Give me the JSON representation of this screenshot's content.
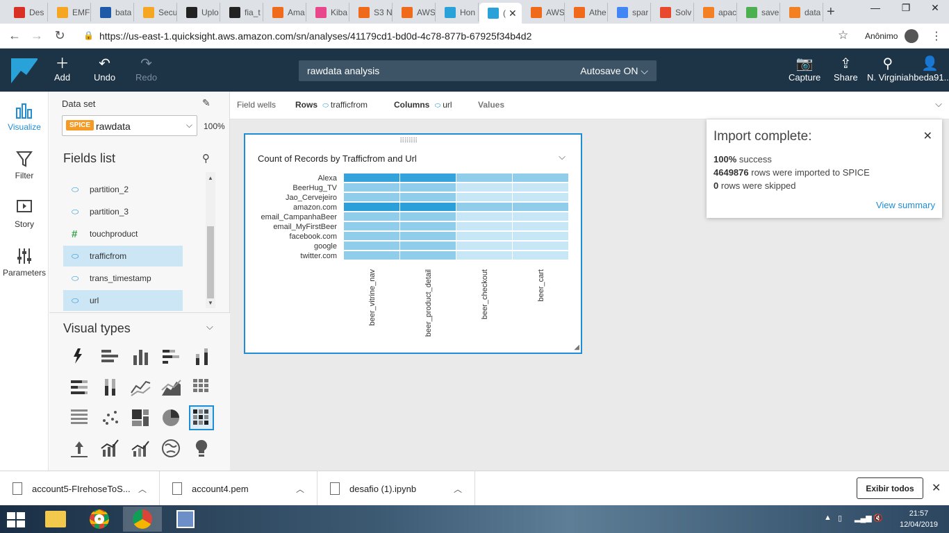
{
  "browser": {
    "tabs": [
      {
        "label": "Des",
        "favicon": "gmail-icon",
        "color": "#d93025"
      },
      {
        "label": "EMF",
        "favicon": "aws-icon",
        "color": "#f5a623"
      },
      {
        "label": "bata",
        "favicon": "feather-icon",
        "color": "#1e5aa8"
      },
      {
        "label": "Secu",
        "favicon": "aws-icon",
        "color": "#f5a623"
      },
      {
        "label": "Uplo",
        "favicon": "github-icon",
        "color": "#222222"
      },
      {
        "label": "fia_t",
        "favicon": "github-icon",
        "color": "#222222"
      },
      {
        "label": "Ama",
        "favicon": "aws-service-icon",
        "color": "#f06a1c"
      },
      {
        "label": "Kiba",
        "favicon": "kibana-icon",
        "color": "#e8478b"
      },
      {
        "label": "S3 N",
        "favicon": "aws-service-icon",
        "color": "#f06a1c"
      },
      {
        "label": "AWS",
        "favicon": "aws-service-icon",
        "color": "#f06a1c"
      },
      {
        "label": "Hon",
        "favicon": "quicksight-icon",
        "color": "#29a1d9"
      },
      {
        "label": "(",
        "favicon": "quicksight-icon",
        "color": "#29a1d9"
      },
      {
        "label": "AWS",
        "favicon": "aws-service-icon",
        "color": "#f06a1c"
      },
      {
        "label": "Athe",
        "favicon": "aws-service-icon",
        "color": "#f06a1c"
      },
      {
        "label": "spar",
        "favicon": "google-icon",
        "color": "#4285f4"
      },
      {
        "label": "Solv",
        "favicon": "solver-icon",
        "color": "#e8482c"
      },
      {
        "label": "apac",
        "favicon": "stackoverflow-icon",
        "color": "#f48024"
      },
      {
        "label": "save",
        "favicon": "mongodb-icon",
        "color": "#4caf50"
      },
      {
        "label": "data",
        "favicon": "stackoverflow-icon",
        "color": "#f48024"
      }
    ],
    "active_tab_index": 11,
    "url": "https://us-east-1.quicksight.aws.amazon.com/sn/analyses/41179cd1-bd0d-4c78-877b-67925f34b4d2",
    "incognito_label": "Anônimo"
  },
  "header": {
    "add": "Add",
    "undo": "Undo",
    "redo": "Redo",
    "analysis_name": "rawdata analysis",
    "autosave": "Autosave ON",
    "capture": "Capture",
    "share": "Share",
    "region": "N. Virginia",
    "user": "hbeda91..."
  },
  "rail": {
    "visualize": "Visualize",
    "filter": "Filter",
    "story": "Story",
    "parameters": "Parameters"
  },
  "data_panel": {
    "dataset_label": "Data set",
    "spice_badge": "SPICE",
    "dataset_name": "rawdata",
    "spice_percent": "100%",
    "fields_title": "Fields list",
    "fields": [
      {
        "name": "partition_2",
        "type": "dimension",
        "selected": false
      },
      {
        "name": "partition_3",
        "type": "dimension",
        "selected": false
      },
      {
        "name": "touchproduct",
        "type": "measure",
        "selected": false
      },
      {
        "name": "trafficfrom",
        "type": "dimension",
        "selected": true
      },
      {
        "name": "trans_timestamp",
        "type": "dimension",
        "selected": false
      },
      {
        "name": "url",
        "type": "dimension",
        "selected": true
      }
    ],
    "visual_types_title": "Visual types",
    "visual_types": [
      "autograph",
      "horizontal-bar",
      "vertical-bar",
      "horizontal-stacked-bar",
      "vertical-stacked-bar",
      "horizontal-100-bar",
      "vertical-100-bar",
      "line",
      "area-line",
      "pivot-table",
      "table",
      "scatter",
      "tree-map",
      "pie",
      "heat-map",
      "kpi",
      "combo-bar-line",
      "combo-stacked-line",
      "geospatial",
      "insight"
    ],
    "selected_visual_type": "heat-map"
  },
  "field_wells": {
    "label": "Field wells",
    "rows_label": "Rows",
    "rows_value": "trafficfrom",
    "columns_label": "Columns",
    "columns_value": "url",
    "values_label": "Values"
  },
  "visual": {
    "title": "Count of Records by Trafficfrom and Url"
  },
  "chart_data": {
    "type": "heatmap",
    "title": "Count of Records by Trafficfrom and Url",
    "rows": [
      "Alexa",
      "BeerHug_TV",
      "Jao_Cervejeiro",
      "amazon.com",
      "email_CampanhaBeer",
      "email_MyFirstBeer",
      "facebook.com",
      "google",
      "twitter.com"
    ],
    "columns": [
      "beer_vitrine_nav",
      "beer_product_detail",
      "beer_checkout",
      "beer_cart"
    ],
    "intensity": [
      [
        0.95,
        0.95,
        0.45,
        0.45
      ],
      [
        0.45,
        0.45,
        0.15,
        0.15
      ],
      [
        0.45,
        0.45,
        0.15,
        0.15
      ],
      [
        1.0,
        1.0,
        0.45,
        0.45
      ],
      [
        0.45,
        0.45,
        0.15,
        0.15
      ],
      [
        0.45,
        0.45,
        0.15,
        0.15
      ],
      [
        0.45,
        0.45,
        0.15,
        0.15
      ],
      [
        0.45,
        0.45,
        0.15,
        0.15
      ],
      [
        0.45,
        0.45,
        0.15,
        0.15
      ]
    ],
    "color_low": "#e3f3fb",
    "color_high": "#2a9fd8"
  },
  "toast": {
    "title": "Import complete:",
    "success_pct": "100%",
    "success_text": "success",
    "rows_imported": "4649876",
    "rows_imported_text": "rows were imported to SPICE",
    "rows_skipped": "0",
    "rows_skipped_text": "rows were skipped",
    "link": "View summary"
  },
  "downloads": {
    "items": [
      "account5-FIrehoseToS...",
      "account4.pem",
      "desafio (1).ipynb"
    ],
    "show_all": "Exibir todos"
  },
  "taskbar": {
    "time": "21:57",
    "date": "12/04/2019"
  },
  "colors": {
    "qs_header": "#1d3447",
    "accent": "#1f8dd6",
    "spice": "#f59b25"
  }
}
